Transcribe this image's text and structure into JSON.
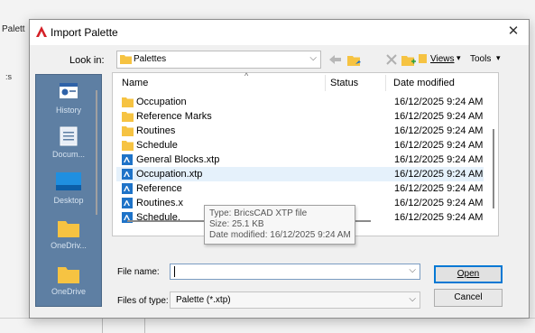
{
  "background": {
    "left_label": "Palett",
    "left_small": ":s"
  },
  "dialog": {
    "title": "Import Palette",
    "close_glyph": "✕"
  },
  "lookin": {
    "label": "Look in:",
    "value": "Palettes",
    "chevron": "⌵"
  },
  "toolbar": {
    "views": "Views",
    "views_drop": "▾",
    "tools": "Tools",
    "tools_drop": "▾"
  },
  "places": [
    {
      "label": "History",
      "icon": "history-icon"
    },
    {
      "label": "Docum...",
      "icon": "documents-icon"
    },
    {
      "label": "Desktop",
      "icon": "desktop-icon"
    },
    {
      "label": "OneDriv...",
      "icon": "folder-icon"
    },
    {
      "label": "OneDrive",
      "icon": "folder-icon"
    }
  ],
  "columns": {
    "name": "Name",
    "status": "Status",
    "date": "Date modified",
    "sort_caret": "^"
  },
  "files": [
    {
      "name": "Occupation",
      "type": "folder",
      "date": "16/12/2025 9:24 AM"
    },
    {
      "name": "Reference Marks",
      "type": "folder",
      "date": "16/12/2025 9:24 AM"
    },
    {
      "name": "Routines",
      "type": "folder",
      "date": "16/12/2025 9:24 AM"
    },
    {
      "name": "Schedule",
      "type": "folder",
      "date": "16/12/2025 9:24 AM"
    },
    {
      "name": "General Blocks.xtp",
      "type": "xtp",
      "date": "16/12/2025 9:24 AM"
    },
    {
      "name": "Occupation.xtp",
      "type": "xtp",
      "date": "16/12/2025 9:24 AM",
      "selected": true
    },
    {
      "name": "Reference",
      "type": "xtp",
      "date": "16/12/2025 9:24 AM"
    },
    {
      "name": "Routines.x",
      "type": "xtp",
      "date": "16/12/2025 9:24 AM"
    },
    {
      "name": "Schedule.",
      "type": "xtp",
      "date": "16/12/2025 9:24 AM"
    }
  ],
  "tooltip": {
    "type": "Type: BricsCAD XTP file",
    "size": "Size: 25.1 KB",
    "date": "Date modified: 16/12/2025 9:24 AM"
  },
  "filename": {
    "label": "File name:",
    "value": "",
    "chevron": "⌵"
  },
  "filetype": {
    "label": "Files of type:",
    "value": "Palette (*.xtp)",
    "chevron": "⌵"
  },
  "buttons": {
    "open": "Open",
    "cancel": "Cancel"
  },
  "colors": {
    "accent": "#0078d4",
    "folder": "#f6c342",
    "places_bg": "#5e7fa3",
    "xtp_icon": "#1e73c8"
  }
}
